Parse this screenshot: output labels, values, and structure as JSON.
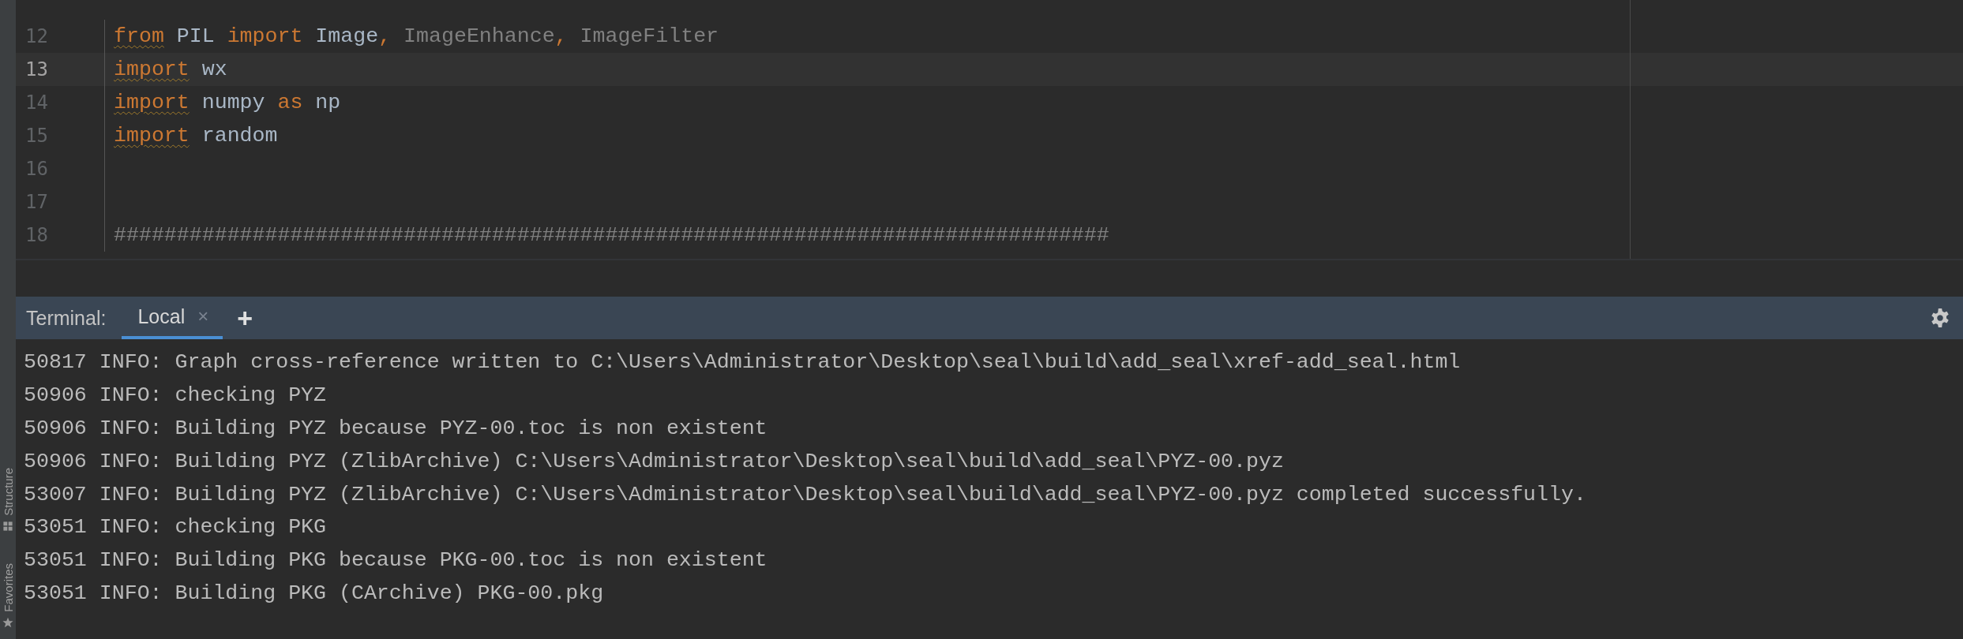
{
  "side_strip": {
    "tool_windows": [
      {
        "label": "Structure",
        "kind": "structure"
      },
      {
        "label": "Favorites",
        "kind": "favorites"
      }
    ]
  },
  "editor": {
    "lines": [
      {
        "number": "12",
        "current": false,
        "tokens": [
          {
            "text": "from",
            "kind": "keyword",
            "underlined": true
          },
          {
            "text": " PIL ",
            "kind": "name",
            "underlined": false
          },
          {
            "text": "import",
            "kind": "keyword",
            "underlined": false
          },
          {
            "text": " Image",
            "kind": "name",
            "underlined": false
          },
          {
            "text": ", ",
            "kind": "keyword",
            "underlined": false
          },
          {
            "text": "ImageEnhance",
            "kind": "unused",
            "underlined": false
          },
          {
            "text": ", ",
            "kind": "keyword",
            "underlined": false
          },
          {
            "text": "ImageFilter",
            "kind": "unused",
            "underlined": false
          }
        ]
      },
      {
        "number": "13",
        "current": true,
        "tokens": [
          {
            "text": "import",
            "kind": "keyword",
            "underlined": true
          },
          {
            "text": " wx",
            "kind": "name",
            "underlined": false
          }
        ]
      },
      {
        "number": "14",
        "current": false,
        "tokens": [
          {
            "text": "import",
            "kind": "keyword",
            "underlined": true
          },
          {
            "text": " numpy ",
            "kind": "name",
            "underlined": false
          },
          {
            "text": "as",
            "kind": "keyword",
            "underlined": false
          },
          {
            "text": " np",
            "kind": "name",
            "underlined": false
          }
        ]
      },
      {
        "number": "15",
        "current": false,
        "tokens": [
          {
            "text": "import",
            "kind": "keyword",
            "underlined": true
          },
          {
            "text": " random",
            "kind": "name",
            "underlined": false
          }
        ]
      },
      {
        "number": "16",
        "current": false
      },
      {
        "number": "17",
        "current": false
      },
      {
        "number": "18",
        "current": false,
        "tokens": [
          {
            "text": "###############################################################################",
            "kind": "comment",
            "underlined": false
          }
        ]
      }
    ]
  },
  "terminal": {
    "title": "Terminal:",
    "tabs": [
      {
        "label": "Local",
        "selected": true,
        "close": "×"
      }
    ],
    "add": "+",
    "lines": [
      "50817 INFO: Graph cross-reference written to C:\\Users\\Administrator\\Desktop\\seal\\build\\add_seal\\xref-add_seal.html",
      "50906 INFO: checking PYZ",
      "50906 INFO: Building PYZ because PYZ-00.toc is non existent",
      "50906 INFO: Building PYZ (ZlibArchive) C:\\Users\\Administrator\\Desktop\\seal\\build\\add_seal\\PYZ-00.pyz",
      "53007 INFO: Building PYZ (ZlibArchive) C:\\Users\\Administrator\\Desktop\\seal\\build\\add_seal\\PYZ-00.pyz completed successfully.",
      "53051 INFO: checking PKG",
      "53051 INFO: Building PKG because PKG-00.toc is non existent",
      "53051 INFO: Building PKG (CArchive) PKG-00.pkg"
    ]
  }
}
